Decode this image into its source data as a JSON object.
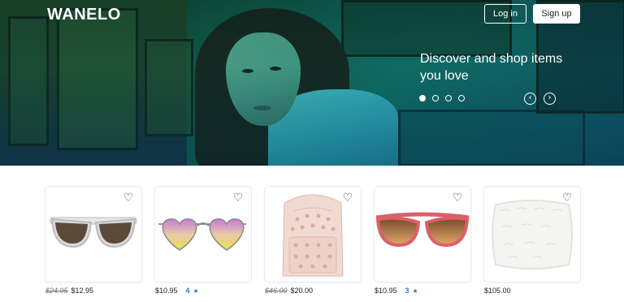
{
  "header": {
    "logo": "WANELO",
    "login_label": "Log in",
    "signup_label": "Sign up"
  },
  "hero": {
    "tagline": "Discover and shop items you love",
    "slides": 4,
    "active_slide": 1,
    "prev_icon": "chevron-left-icon",
    "next_icon": "chevron-right-icon"
  },
  "products": [
    {
      "name": "white-sunglasses",
      "old_price": "$24.95",
      "price": "$12.95",
      "saves": ""
    },
    {
      "name": "heart-sunglasses",
      "old_price": "",
      "price": "$10.95",
      "saves": "4"
    },
    {
      "name": "heart-backpack",
      "old_price": "$46.00",
      "price": "$20.00",
      "saves": ""
    },
    {
      "name": "pink-cat-eye-sunglasses",
      "old_price": "",
      "price": "$10.95",
      "saves": "3"
    },
    {
      "name": "faux-fur-pillow",
      "old_price": "",
      "price": "$105.00",
      "saves": ""
    }
  ],
  "colors": {
    "accent_blue": "#2a7bbf",
    "hero_green": "#0f5646",
    "hero_teal": "#0e4f63"
  }
}
